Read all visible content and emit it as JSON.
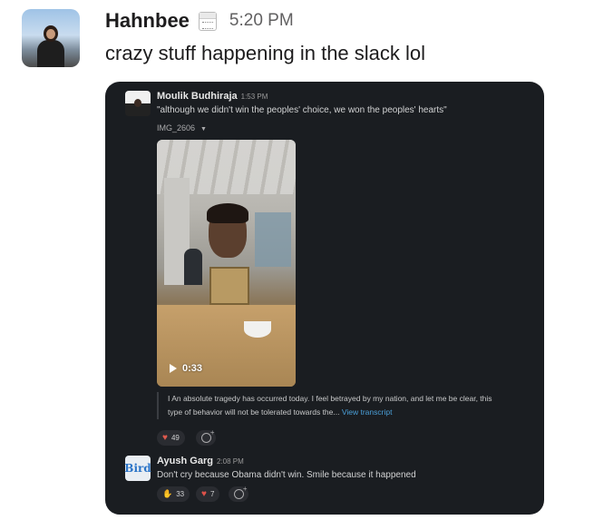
{
  "outer_message": {
    "sender": "Hahnbee",
    "status_icon": "calendar-icon",
    "time": "5:20 PM",
    "text": "crazy stuff happening in the slack lol"
  },
  "embedded_screenshot": {
    "original_message": {
      "sender": "Moulik Budhiraja",
      "time": "1:53 PM",
      "quote": "\"although we didn't win the peoples' choice, we won the peoples' hearts\"",
      "file_name": "IMG_2606",
      "video_duration": "0:33",
      "transcript": "I An absolute tragedy has occurred today. I feel betrayed by my nation, and let me be clear, this type of behavior will not be tolerated towards the...",
      "transcript_link": "View transcript",
      "reactions": [
        {
          "icon": "heart-icon",
          "count": "49"
        }
      ]
    },
    "reply_message": {
      "avatar_text": "Bird",
      "sender": "Ayush Garg",
      "time": "2:08 PM",
      "text": "Don't cry because Obama didn't win. Smile because it happened",
      "reactions": [
        {
          "icon": "praying-hands-icon",
          "count": "33"
        },
        {
          "icon": "broken-heart-icon",
          "count": "7"
        }
      ]
    }
  },
  "colors": {
    "card_background": "#1a1d21",
    "link": "#4a9fd8",
    "heart": "#e05a4e"
  }
}
